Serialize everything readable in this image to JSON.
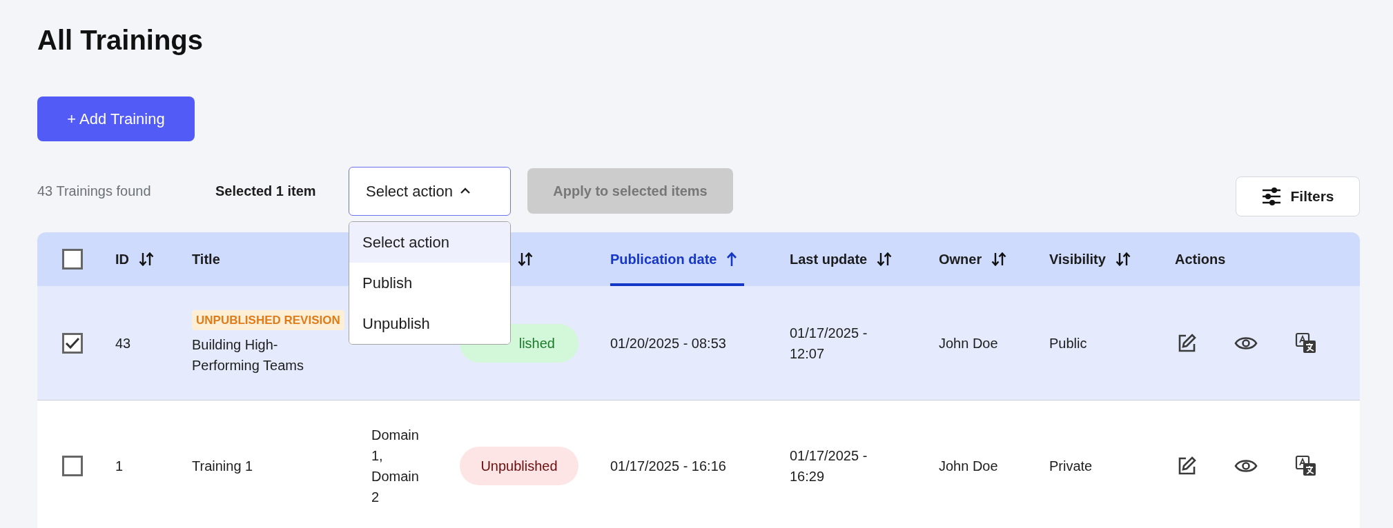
{
  "page": {
    "title": "All Trainings"
  },
  "add_button": "+ Add Training",
  "toolbar": {
    "count": "43 Trainings found",
    "selection": "Selected 1 item",
    "action_select": {
      "value": "Select action",
      "expanded": true,
      "options": [
        {
          "label": "Select action",
          "selected": true
        },
        {
          "label": "Publish",
          "selected": false
        },
        {
          "label": "Unpublish",
          "selected": false
        }
      ]
    },
    "apply_button": {
      "label": "Apply to selected items",
      "disabled": true
    },
    "filters_button": "Filters"
  },
  "table": {
    "header_checkbox": {
      "checked": false
    },
    "columns": [
      {
        "label": "ID",
        "sortable": true,
        "sorted": false
      },
      {
        "label": "Title",
        "sortable": false,
        "sorted": false
      },
      {
        "sortable": true,
        "sorted": false
      },
      {
        "label": "Publication date",
        "sortable": true,
        "sorted": true
      },
      {
        "label": "Last update",
        "sortable": true,
        "sorted": false
      },
      {
        "label": "Owner",
        "sortable": true,
        "sorted": false
      },
      {
        "label": "Visibility",
        "sortable": true,
        "sorted": false
      },
      {
        "label": "Actions",
        "sortable": false,
        "sorted": false
      }
    ],
    "rows": [
      {
        "checked": true,
        "id": "43",
        "badge": "UNPUBLISHED REVISION",
        "title": "Building High-Performing Teams",
        "status": {
          "label": "lished",
          "kind": "published"
        },
        "publication_date": "01/20/2025 - 08:53",
        "last_update": "01/17/2025 - 12:07",
        "owner": "John Doe",
        "visibility": "Public"
      },
      {
        "checked": false,
        "id": "1",
        "title": "Training 1",
        "domains": "Domain 1, Domain 2",
        "status": {
          "label": "Unpublished",
          "kind": "unpublished"
        },
        "publication_date": "01/17/2025 - 16:16",
        "last_update": "01/17/2025 - 16:29",
        "owner": "John Doe",
        "visibility": "Private"
      }
    ]
  }
}
